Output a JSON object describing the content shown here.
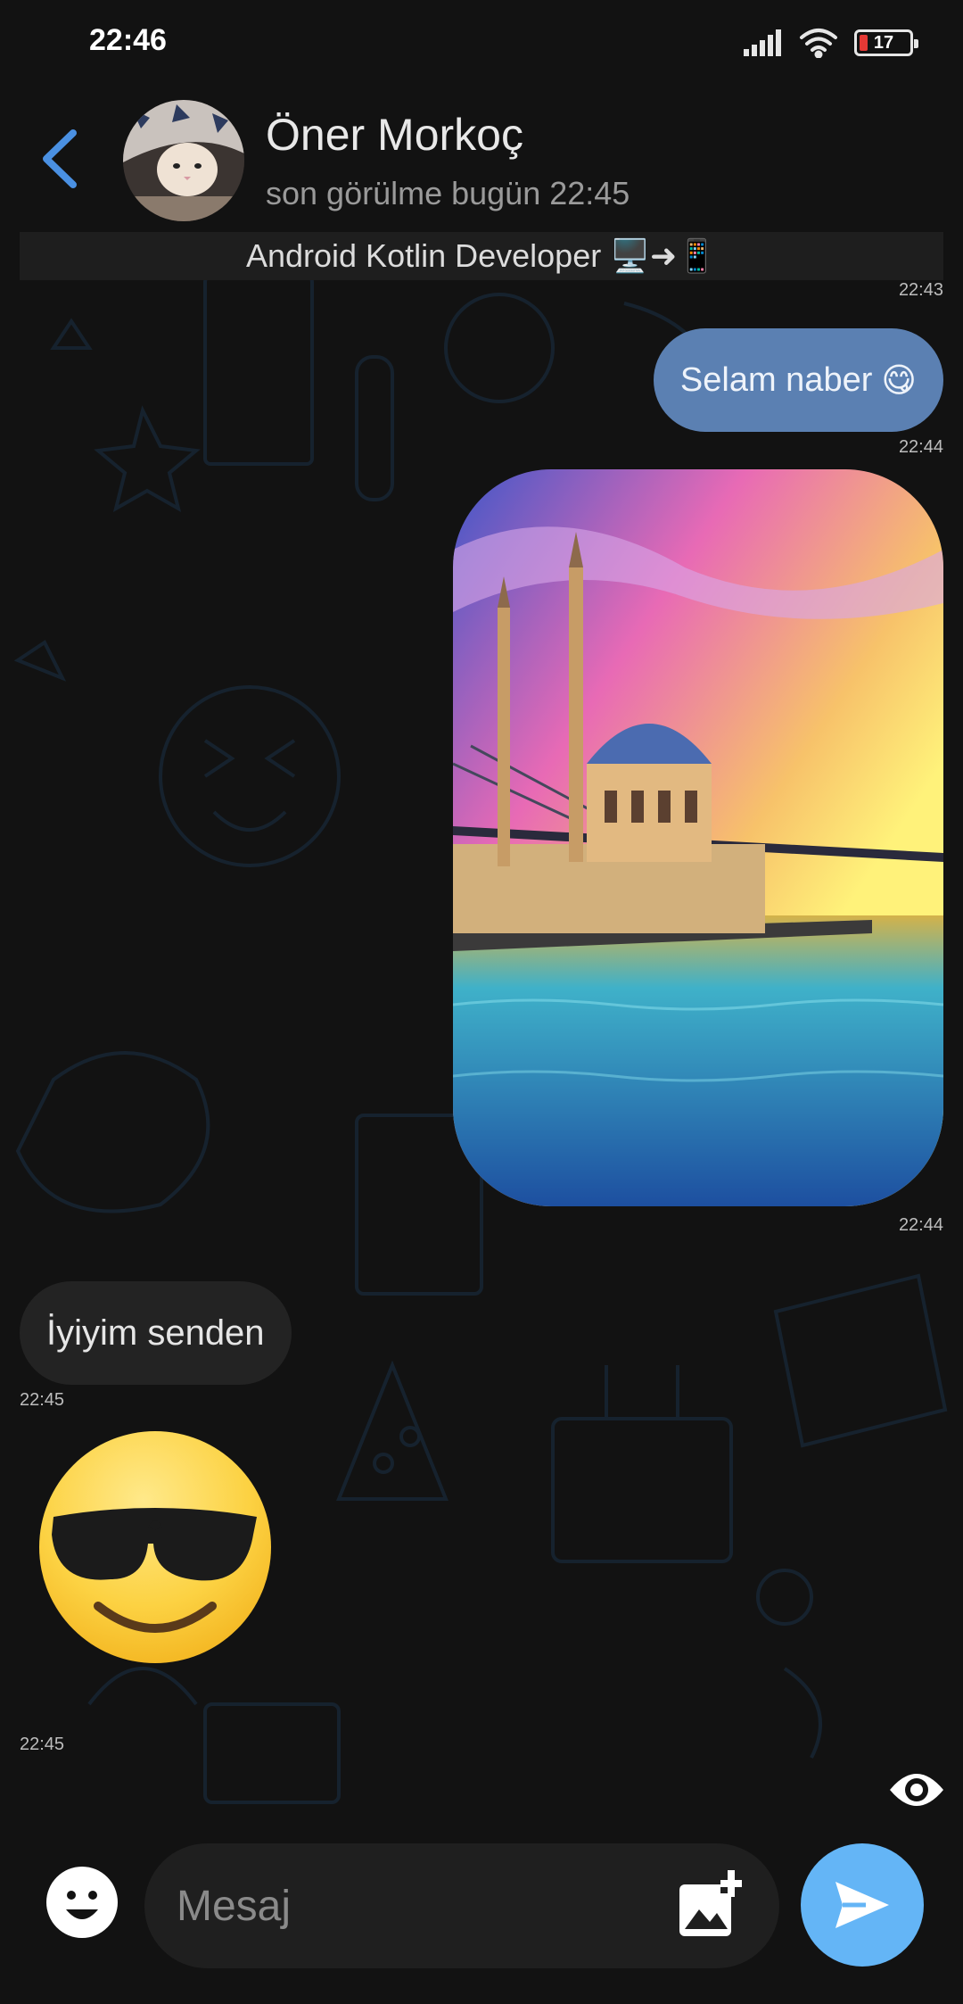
{
  "status_bar": {
    "time": "22:46",
    "battery": "17"
  },
  "header": {
    "contact_name": "Öner Morkoç",
    "last_seen": "son görülme bugün 22:45",
    "pinned_bio": "Android Kotlin Developer",
    "pinned_emoji": "🖥️➜📱"
  },
  "messages": [
    {
      "direction": "out",
      "type": "text",
      "text": "Selam naber",
      "emoji": "😋",
      "time": "22:44"
    },
    {
      "direction": "out",
      "type": "image",
      "time": "22:44"
    },
    {
      "direction": "in",
      "type": "text",
      "text": "İyiyim senden",
      "time": "22:45"
    },
    {
      "direction": "in",
      "type": "sticker",
      "emoji": "sunglasses-smile",
      "time": "22:45"
    }
  ],
  "top_time": "22:43",
  "composer": {
    "placeholder": "Mesaj"
  },
  "colors": {
    "background": "#121212",
    "outgoing_bubble": "#5b80b2",
    "incoming_bubble": "#232323",
    "accent": "#64b5f6"
  }
}
